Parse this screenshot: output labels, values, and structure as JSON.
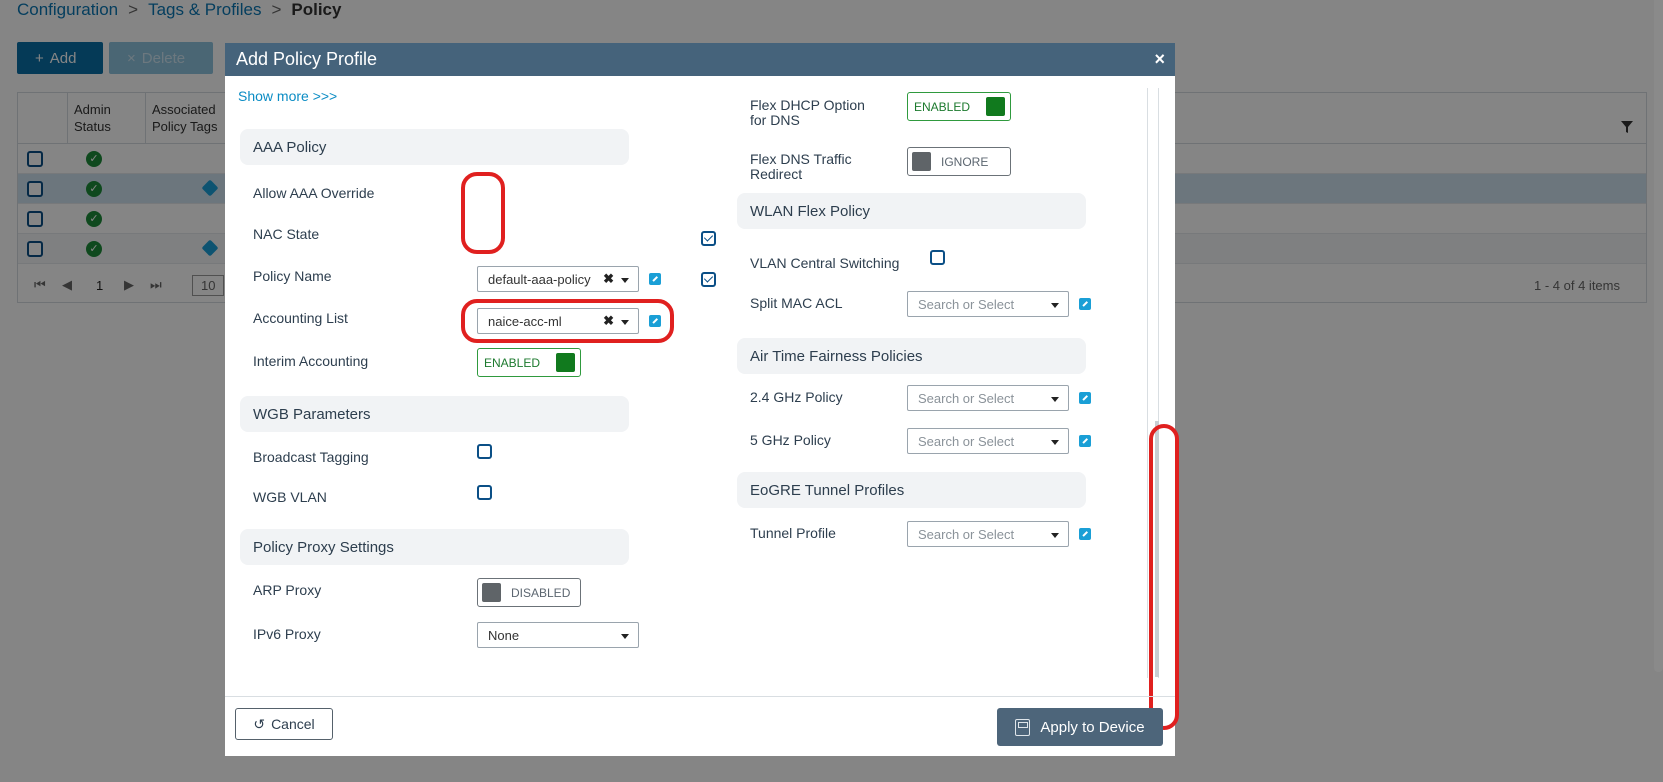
{
  "breadcrumb": {
    "item1": "Configuration",
    "item2": "Tags & Profiles",
    "current": "Policy",
    "sep": ">"
  },
  "toolbar": {
    "add_label": "Add",
    "delete_label": "Delete",
    "add_icon": "+",
    "delete_icon": "×"
  },
  "table": {
    "col_admin_status": "Admin Status",
    "col_policy_tags": "Associated Policy Tags",
    "pager_page": "1",
    "pager_size": "10",
    "pager_items": "1 - 4 of 4 items",
    "ok_glyph": "✓"
  },
  "modal": {
    "title": "Add Policy Profile",
    "close_glyph": "×",
    "show_more": "Show more >>>",
    "left": {
      "aaa_policy": {
        "section": "AAA Policy",
        "allow_aaa_override_label": "Allow AAA Override",
        "allow_aaa_override_checked": true,
        "nac_state_label": "NAC State",
        "nac_state_checked": true,
        "policy_name_label": "Policy Name",
        "policy_name_value": "default-aaa-policy",
        "accounting_list_label": "Accounting List",
        "accounting_list_value": "naice-acc-ml",
        "interim_accounting_label": "Interim Accounting",
        "interim_accounting_state": "ENABLED",
        "clear_glyph": "✖"
      },
      "wgb": {
        "section": "WGB Parameters",
        "broadcast_tagging_label": "Broadcast Tagging",
        "wgb_vlan_label": "WGB VLAN"
      },
      "proxy": {
        "section": "Policy Proxy Settings",
        "arp_proxy_label": "ARP Proxy",
        "arp_proxy_state": "DISABLED",
        "ipv6_proxy_label": "IPv6 Proxy",
        "ipv6_proxy_value": "None"
      }
    },
    "right": {
      "flex_dhcp_label_1": "Flex DHCP Option",
      "flex_dhcp_label_2": "for DNS",
      "flex_dhcp_state": "ENABLED",
      "flex_dns_label_1": "Flex DNS Traffic",
      "flex_dns_label_2": "Redirect",
      "flex_dns_state": "IGNORE",
      "wlan_flex": {
        "section": "WLAN Flex Policy",
        "vlan_central_switching_label": "VLAN Central Switching",
        "split_mac_acl_label": "Split MAC ACL",
        "split_mac_acl_placeholder": "Search or Select"
      },
      "atf": {
        "section": "Air Time Fairness Policies",
        "ghz24_label": "2.4 GHz Policy",
        "ghz24_placeholder": "Search or Select",
        "ghz5_label": "5 GHz Policy",
        "ghz5_placeholder": "Search or Select"
      },
      "eogre": {
        "section": "EoGRE Tunnel Profiles",
        "tunnel_profile_label": "Tunnel Profile",
        "tunnel_profile_placeholder": "Search or Select"
      }
    },
    "footer": {
      "cancel_label": "Cancel",
      "cancel_icon": "↺",
      "apply_label": "Apply to Device"
    }
  },
  "colors": {
    "header": "#45637b",
    "accent": "#0b8cc4",
    "enabled": "#117a1e",
    "highlight": "#e0201f"
  }
}
